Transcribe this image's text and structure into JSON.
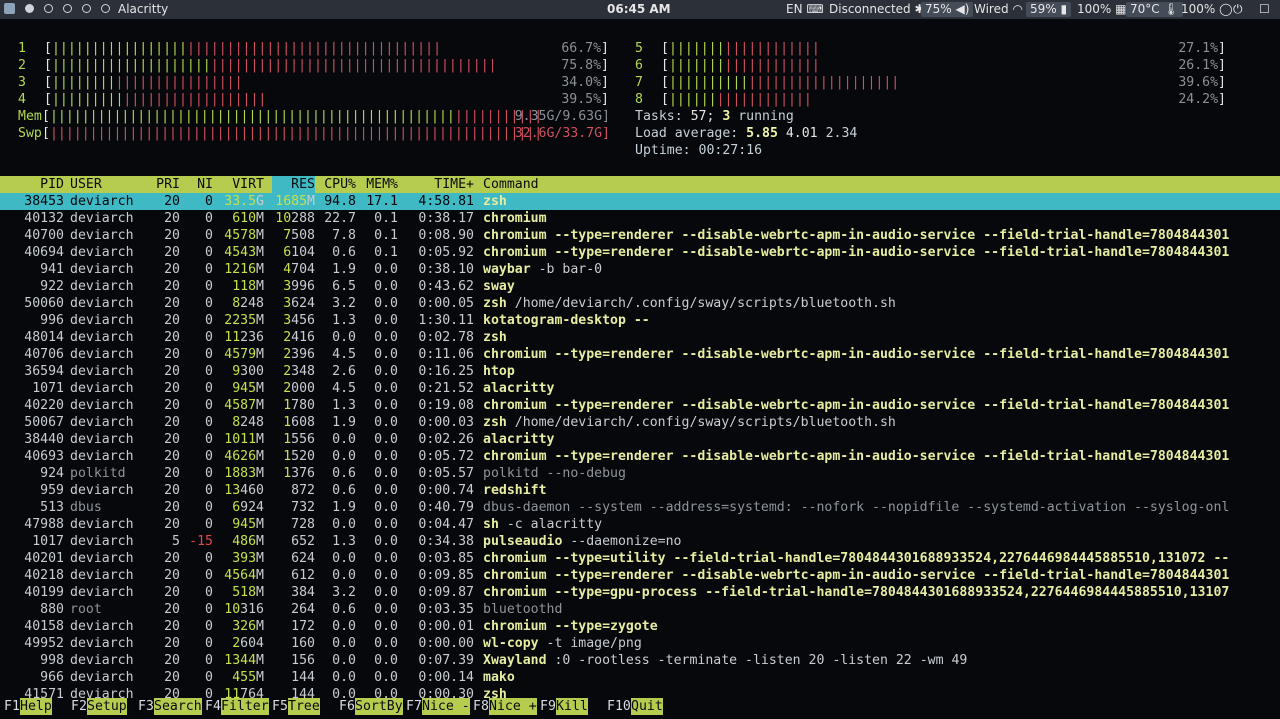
{
  "topbar": {
    "window_title": "Alacritty",
    "clock": "06:45 AM",
    "keyboard_layout": "EN",
    "network": "Disconnected",
    "volume": "75%",
    "wired": "Wired",
    "battery": "59%",
    "cpu": "100%",
    "temperature": "70°C",
    "brightness": "100%"
  },
  "meters": {
    "cpus": [
      {
        "label": "1",
        "value": "66.7%",
        "bars": "[|||||||||||||||||||||||||||||||||||||||||||||||||"
      },
      {
        "label": "2",
        "value": "75.8%",
        "bars": "[||||||||||||||||||||||||||||||||||||||||||||||||||||||||"
      },
      {
        "label": "3",
        "value": "34.0%",
        "bars": "[||||||||||||||||||||||||"
      },
      {
        "label": "4",
        "value": "39.5%",
        "bars": "[|||||||||||||||||||||||||||"
      },
      {
        "label": "5",
        "value": "27.1%",
        "bars": "[|||||||||||||||||||"
      },
      {
        "label": "6",
        "value": "26.1%",
        "bars": "[|||||||||||||||||||"
      },
      {
        "label": "7",
        "value": "39.6%",
        "bars": "[|||||||||||||||||||||||||||||"
      },
      {
        "label": "8",
        "value": "24.2%",
        "bars": "[||||||||||||||||||"
      }
    ],
    "mem": {
      "label": "Mem",
      "bars": "[||||||||||||||||||||||||||||||||||||||||||||||||||||||||||||||",
      "value": "9.35G/9.63G]"
    },
    "swp": {
      "label": "Swp",
      "bars": "[||||||||||||||||||||||||||||||||||||||||||||||||||||||||||||||",
      "value": "32.6G/33.7G]"
    },
    "tasks": {
      "label": "Tasks:",
      "count": "57;",
      "running": "3",
      "running_label": "running"
    },
    "load": {
      "label": "Load average:",
      "one": "5.85",
      "five": "4.01",
      "fifteen": "2.34"
    },
    "uptime": {
      "label": "Uptime:",
      "value": "00:27:16"
    }
  },
  "columns": [
    "PID",
    "USER",
    "PRI",
    "NI",
    "VIRT",
    "RES",
    "CPU%",
    "MEM%",
    "TIME+",
    "Command"
  ],
  "processes": [
    {
      "pid": "38453",
      "user": "deviarch",
      "pri": "20",
      "ni": "0",
      "virt": "33.5G",
      "res": "1685M",
      "cpu": "94.8",
      "mem": "17.1",
      "time": "4:58.81",
      "cmd": "zsh",
      "args": ""
    },
    {
      "pid": "40132",
      "user": "deviarch",
      "pri": "20",
      "ni": "0",
      "virt": "610M",
      "res": "10288",
      "cpu": "22.7",
      "mem": "0.1",
      "time": "0:38.17",
      "cmd": "chromium",
      "args": ""
    },
    {
      "pid": "40700",
      "user": "deviarch",
      "pri": "20",
      "ni": "0",
      "virt": "4578M",
      "res": "7508",
      "cpu": "7.8",
      "mem": "0.1",
      "time": "0:08.90",
      "cmd": "chromium --type=renderer --disable-webrtc-apm-in-audio-service --field-trial-handle=7804844301",
      "args": ""
    },
    {
      "pid": "40694",
      "user": "deviarch",
      "pri": "20",
      "ni": "0",
      "virt": "4543M",
      "res": "6104",
      "cpu": "0.6",
      "mem": "0.1",
      "time": "0:05.92",
      "cmd": "chromium --type=renderer --disable-webrtc-apm-in-audio-service --field-trial-handle=7804844301",
      "args": ""
    },
    {
      "pid": "941",
      "user": "deviarch",
      "pri": "20",
      "ni": "0",
      "virt": "1216M",
      "res": "4704",
      "cpu": "1.9",
      "mem": "0.0",
      "time": "0:38.10",
      "cmd": "waybar",
      "args": " -b bar-0"
    },
    {
      "pid": "922",
      "user": "deviarch",
      "pri": "20",
      "ni": "0",
      "virt": "118M",
      "res": "3996",
      "cpu": "6.5",
      "mem": "0.0",
      "time": "0:43.62",
      "cmd": "sway",
      "args": ""
    },
    {
      "pid": "50060",
      "user": "deviarch",
      "pri": "20",
      "ni": "0",
      "virt": "8248",
      "res": "3624",
      "cpu": "3.2",
      "mem": "0.0",
      "time": "0:00.05",
      "cmd": "zsh",
      "args": " /home/deviarch/.config/sway/scripts/bluetooth.sh"
    },
    {
      "pid": "996",
      "user": "deviarch",
      "pri": "20",
      "ni": "0",
      "virt": "2235M",
      "res": "3456",
      "cpu": "1.3",
      "mem": "0.0",
      "time": "1:30.11",
      "cmd": "kotatogram-desktop --",
      "args": ""
    },
    {
      "pid": "48014",
      "user": "deviarch",
      "pri": "20",
      "ni": "0",
      "virt": "11236",
      "res": "2416",
      "cpu": "0.0",
      "mem": "0.0",
      "time": "0:02.78",
      "cmd": "zsh",
      "args": ""
    },
    {
      "pid": "40706",
      "user": "deviarch",
      "pri": "20",
      "ni": "0",
      "virt": "4579M",
      "res": "2396",
      "cpu": "4.5",
      "mem": "0.0",
      "time": "0:11.06",
      "cmd": "chromium --type=renderer --disable-webrtc-apm-in-audio-service --field-trial-handle=7804844301",
      "args": ""
    },
    {
      "pid": "36594",
      "user": "deviarch",
      "pri": "20",
      "ni": "0",
      "virt": "9300",
      "res": "2348",
      "cpu": "2.6",
      "mem": "0.0",
      "time": "0:16.25",
      "cmd": "htop",
      "args": ""
    },
    {
      "pid": "1071",
      "user": "deviarch",
      "pri": "20",
      "ni": "0",
      "virt": "945M",
      "res": "2000",
      "cpu": "4.5",
      "mem": "0.0",
      "time": "0:21.52",
      "cmd": "alacritty",
      "args": ""
    },
    {
      "pid": "40220",
      "user": "deviarch",
      "pri": "20",
      "ni": "0",
      "virt": "4587M",
      "res": "1780",
      "cpu": "1.3",
      "mem": "0.0",
      "time": "0:19.08",
      "cmd": "chromium --type=renderer --disable-webrtc-apm-in-audio-service --field-trial-handle=7804844301",
      "args": ""
    },
    {
      "pid": "50067",
      "user": "deviarch",
      "pri": "20",
      "ni": "0",
      "virt": "8248",
      "res": "1608",
      "cpu": "1.9",
      "mem": "0.0",
      "time": "0:00.03",
      "cmd": "zsh",
      "args": " /home/deviarch/.config/sway/scripts/bluetooth.sh"
    },
    {
      "pid": "38440",
      "user": "deviarch",
      "pri": "20",
      "ni": "0",
      "virt": "1011M",
      "res": "1556",
      "cpu": "0.0",
      "mem": "0.0",
      "time": "0:02.26",
      "cmd": "alacritty",
      "args": ""
    },
    {
      "pid": "40693",
      "user": "deviarch",
      "pri": "20",
      "ni": "0",
      "virt": "4626M",
      "res": "1520",
      "cpu": "0.0",
      "mem": "0.0",
      "time": "0:05.72",
      "cmd": "chromium --type=renderer --disable-webrtc-apm-in-audio-service --field-trial-handle=7804844301",
      "args": ""
    },
    {
      "pid": "924",
      "user": "polkitd",
      "pri": "20",
      "ni": "0",
      "virt": "1883M",
      "res": "1376",
      "cpu": "0.6",
      "mem": "0.0",
      "time": "0:05.57",
      "cmd": "",
      "args": "polkitd --no-debug"
    },
    {
      "pid": "959",
      "user": "deviarch",
      "pri": "20",
      "ni": "0",
      "virt": "13460",
      "res": "872",
      "cpu": "0.6",
      "mem": "0.0",
      "time": "0:00.74",
      "cmd": "redshift",
      "args": ""
    },
    {
      "pid": "513",
      "user": "dbus",
      "pri": "20",
      "ni": "0",
      "virt": "6924",
      "res": "732",
      "cpu": "1.9",
      "mem": "0.0",
      "time": "0:40.79",
      "cmd": "",
      "args": "dbus-daemon --system --address=systemd: --nofork --nopidfile --systemd-activation --syslog-onl"
    },
    {
      "pid": "47988",
      "user": "deviarch",
      "pri": "20",
      "ni": "0",
      "virt": "945M",
      "res": "728",
      "cpu": "0.0",
      "mem": "0.0",
      "time": "0:04.47",
      "cmd": "sh",
      "args": " -c alacritty"
    },
    {
      "pid": "1017",
      "user": "deviarch",
      "pri": "5",
      "ni": "-15",
      "virt": "486M",
      "res": "652",
      "cpu": "1.3",
      "mem": "0.0",
      "time": "0:34.38",
      "cmd": "pulseaudio",
      "args": " --daemonize=no"
    },
    {
      "pid": "40201",
      "user": "deviarch",
      "pri": "20",
      "ni": "0",
      "virt": "393M",
      "res": "624",
      "cpu": "0.0",
      "mem": "0.0",
      "time": "0:03.85",
      "cmd": "chromium --type=utility --field-trial-handle=7804844301688933524,2276446984445885510,131072 --",
      "args": ""
    },
    {
      "pid": "40218",
      "user": "deviarch",
      "pri": "20",
      "ni": "0",
      "virt": "4564M",
      "res": "612",
      "cpu": "0.0",
      "mem": "0.0",
      "time": "0:09.85",
      "cmd": "chromium --type=renderer --disable-webrtc-apm-in-audio-service --field-trial-handle=7804844301",
      "args": ""
    },
    {
      "pid": "40199",
      "user": "deviarch",
      "pri": "20",
      "ni": "0",
      "virt": "518M",
      "res": "384",
      "cpu": "3.2",
      "mem": "0.0",
      "time": "0:09.87",
      "cmd": "chromium --type=gpu-process --field-trial-handle=7804844301688933524,2276446984445885510,13107",
      "args": ""
    },
    {
      "pid": "880",
      "user": "root",
      "pri": "20",
      "ni": "0",
      "virt": "10316",
      "res": "264",
      "cpu": "0.6",
      "mem": "0.0",
      "time": "0:03.35",
      "cmd": "",
      "args": "bluetoothd"
    },
    {
      "pid": "40158",
      "user": "deviarch",
      "pri": "20",
      "ni": "0",
      "virt": "326M",
      "res": "172",
      "cpu": "0.0",
      "mem": "0.0",
      "time": "0:00.01",
      "cmd": "chromium --type=zygote",
      "args": ""
    },
    {
      "pid": "49952",
      "user": "deviarch",
      "pri": "20",
      "ni": "0",
      "virt": "2604",
      "res": "160",
      "cpu": "0.0",
      "mem": "0.0",
      "time": "0:00.00",
      "cmd": "wl-copy",
      "args": " -t image/png"
    },
    {
      "pid": "998",
      "user": "deviarch",
      "pri": "20",
      "ni": "0",
      "virt": "1344M",
      "res": "156",
      "cpu": "0.0",
      "mem": "0.0",
      "time": "0:07.39",
      "cmd": "Xwayland",
      "args": " :0 -rootless -terminate -listen 20 -listen 22 -wm 49"
    },
    {
      "pid": "966",
      "user": "deviarch",
      "pri": "20",
      "ni": "0",
      "virt": "455M",
      "res": "144",
      "cpu": "0.0",
      "mem": "0.0",
      "time": "0:00.14",
      "cmd": "mako",
      "args": ""
    },
    {
      "pid": "41571",
      "user": "deviarch",
      "pri": "20",
      "ni": "0",
      "virt": "11764",
      "res": "144",
      "cpu": "0.0",
      "mem": "0.0",
      "time": "0:00.30",
      "cmd": "zsh",
      "args": ""
    }
  ],
  "fkeys": [
    {
      "key": "F1",
      "label": "Help  "
    },
    {
      "key": "F2",
      "label": "Setup "
    },
    {
      "key": "F3",
      "label": "Search"
    },
    {
      "key": "F4",
      "label": "Filter"
    },
    {
      "key": "F5",
      "label": "Tree  "
    },
    {
      "key": "F6",
      "label": "SortBy"
    },
    {
      "key": "F7",
      "label": "Nice -"
    },
    {
      "key": "F8",
      "label": "Nice +"
    },
    {
      "key": "F9",
      "label": "Kill  "
    },
    {
      "key": "F10",
      "label": "Quit"
    }
  ]
}
